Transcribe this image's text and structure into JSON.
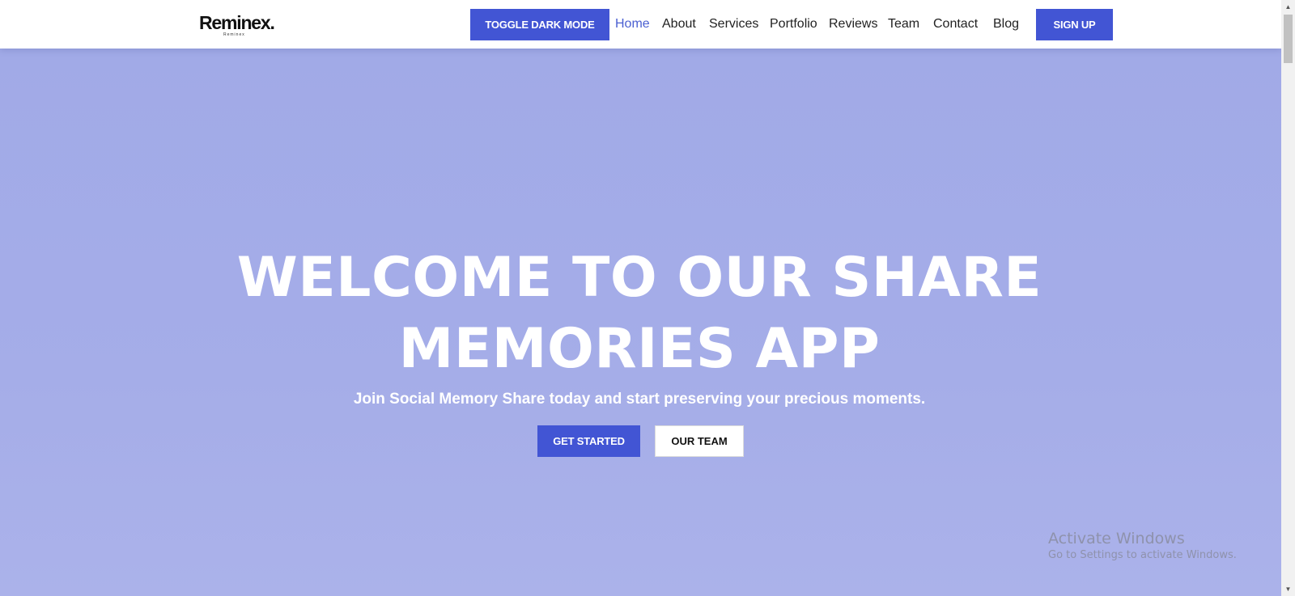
{
  "header": {
    "logo": {
      "text": "Reminex.",
      "subtext": "Reminex"
    },
    "toggle_dark_mode_label": "TOGGLE DARK MODE",
    "nav": [
      {
        "label": "Home",
        "active": true
      },
      {
        "label": "About"
      },
      {
        "label": "Services"
      },
      {
        "label": "Portfolio"
      },
      {
        "label": "Reviews"
      },
      {
        "label": "Team"
      },
      {
        "label": "Contact"
      },
      {
        "label": "Blog"
      }
    ],
    "signup_label": "SIGN UP"
  },
  "hero": {
    "title_line1": "WELCOME TO OUR SHARE",
    "title_line2": "MEMORIES APP",
    "subtitle": "Join Social Memory Share today and start preserving your precious moments.",
    "get_started_label": "GET STARTED",
    "our_team_label": "OUR TEAM"
  },
  "watermark": {
    "title": "Activate Windows",
    "subtitle": "Go to Settings to activate Windows."
  },
  "colors": {
    "accent": "#4255d4",
    "active_nav": "#4a5fd1",
    "hero_background": "#a4abe8"
  },
  "icons": {
    "scroll_up": "chevron-up-icon",
    "scroll_down": "chevron-down-icon"
  }
}
